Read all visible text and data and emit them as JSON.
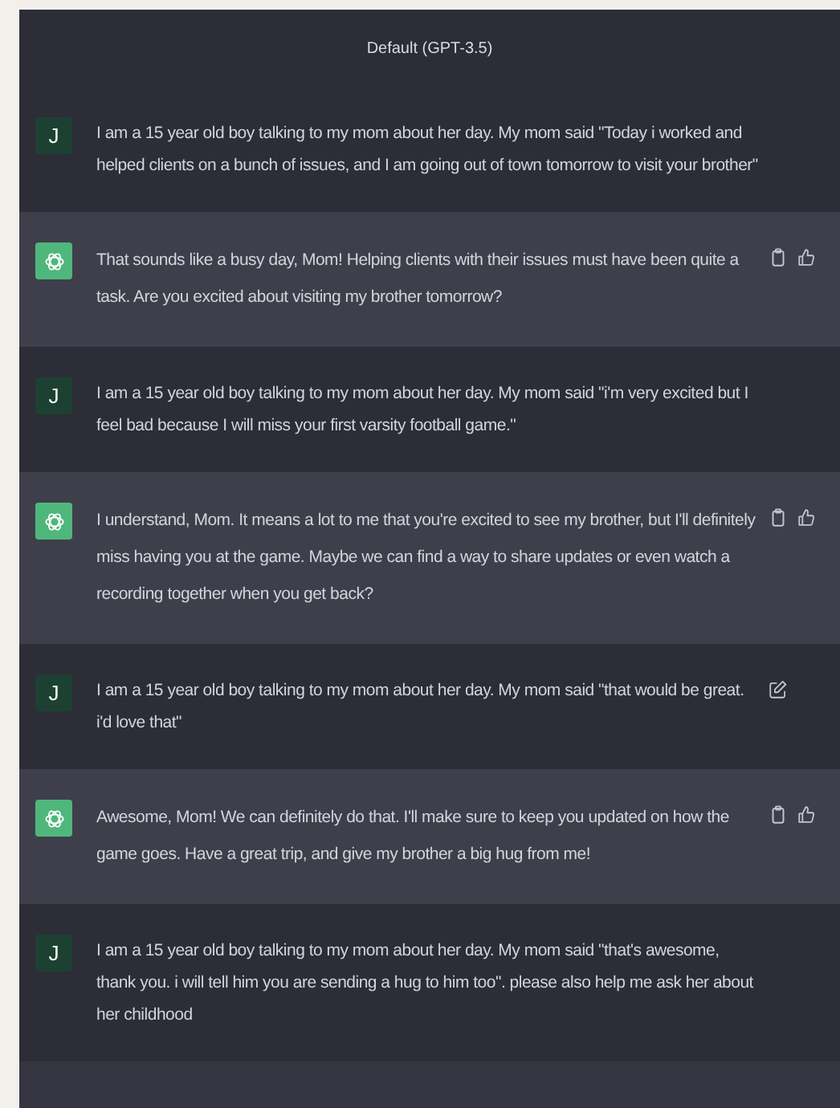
{
  "header": {
    "title": "Default (GPT-3.5)"
  },
  "messages": [
    {
      "kind": "user",
      "avatar": "J",
      "text": "I am a 15 year old boy talking to my mom about her day. My mom said \"Today i worked and helped clients on a bunch of issues, and I am going out of town tomorrow to visit your brother\""
    },
    {
      "kind": "assistant",
      "text": "That sounds like a busy day, Mom! Helping clients with their issues must have been quite a task. Are you excited about visiting my brother tomorrow?",
      "actions": [
        {
          "kind": "copy"
        },
        {
          "kind": "like"
        }
      ]
    },
    {
      "kind": "user",
      "avatar": "J",
      "text": "I am a 15 year old boy talking to my mom about her day. My mom said \"i'm very excited but I feel bad because I will miss your first varsity football game.\""
    },
    {
      "kind": "assistant",
      "text": "I understand, Mom. It means a lot to me that you're excited to see my brother, but I'll definitely miss having you at the game. Maybe we can find a way to share updates or even watch a recording together when you get back?",
      "actions": [
        {
          "kind": "copy"
        },
        {
          "kind": "like"
        }
      ]
    },
    {
      "kind": "user",
      "avatar": "J",
      "text": "I am a 15 year old boy talking to my mom about her day. My mom said \"that would be great. i'd love that\"",
      "actions": [
        {
          "kind": "edit"
        }
      ]
    },
    {
      "kind": "assistant",
      "text": "Awesome, Mom! We can definitely do that. I'll make sure to keep you updated on how the game goes. Have a great trip, and give my brother a big hug from me!",
      "actions": [
        {
          "kind": "copy"
        },
        {
          "kind": "like"
        }
      ]
    },
    {
      "kind": "user",
      "avatar": "J",
      "text": "I am a 15 year old boy talking to my mom about her day. My mom said \"that's awesome, thank you. i will tell him you are sending a hug to him too\". please also help me ask her about her childhood"
    }
  ]
}
